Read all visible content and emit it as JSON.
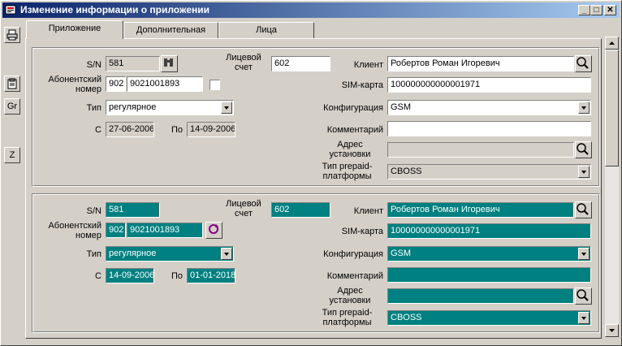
{
  "window": {
    "title": "Изменение информации о приложении",
    "min_glyph": "_",
    "max_glyph": "□",
    "close_glyph": "✕"
  },
  "sidebar": {
    "gr_label": "Gr",
    "z_label": "Z"
  },
  "tabs": [
    "Приложение",
    "Дополнительная",
    "Лица"
  ],
  "labels": {
    "sn": "S/N",
    "abonent": "Абонентский номер",
    "type": "Тип",
    "from": "С",
    "to": "По",
    "account": "Лицевой счет",
    "client": "Клиент",
    "sim": "SIM-карта",
    "config": "Конфигурация",
    "comment": "Комментарий",
    "address": "Адрес установки",
    "prepaid": "Тип prepaid-платформы"
  },
  "record_old": {
    "sn": "581",
    "code": "902",
    "phone": "9021001893",
    "type": "регулярное",
    "from": "27-06-2006",
    "to": "14-09-2006",
    "account": "602",
    "client": "Робертов Роман Игоревич",
    "sim": "100000000000001971",
    "config": "GSM",
    "comment": "",
    "address": "",
    "prepaid": "CBOSS"
  },
  "record_new": {
    "sn": "581",
    "code": "902",
    "phone": "9021001893",
    "type": "регулярное",
    "from": "14-09-2006",
    "to": "01-01-2018",
    "account": "602",
    "client": "Робертов Роман Игоревич",
    "sim": "100000000000001971",
    "config": "GSM",
    "comment": "",
    "address": "",
    "prepaid": "CBOSS"
  },
  "colors": {
    "title_start": "#0a246a",
    "title_end": "#a6caf0",
    "edited_field": "#008080"
  }
}
